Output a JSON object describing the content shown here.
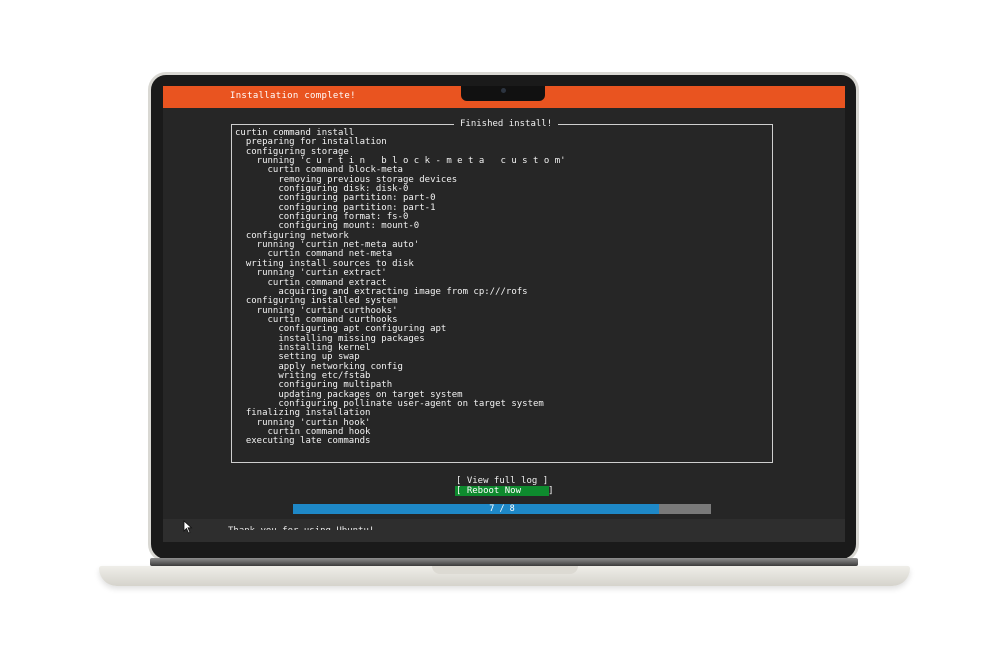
{
  "header": {
    "title": "Installation complete!"
  },
  "log": {
    "frame_title": "Finished install!",
    "lines": [
      "curtin command install",
      "  preparing for installation",
      "  configuring storage",
      "    running 'c u r t i n   b l o c k - m e t a   c u s t o m'",
      "      curtin command block-meta",
      "        removing previous storage devices",
      "        configuring disk: disk-0",
      "        configuring partition: part-0",
      "        configuring partition: part-1",
      "        configuring format: fs-0",
      "        configuring mount: mount-0",
      "  configuring network",
      "    running 'curtin net-meta auto'",
      "      curtin command net-meta",
      "  writing install sources to disk",
      "    running 'curtin extract'",
      "      curtin command extract",
      "        acquiring and extracting image from cp:///rofs",
      "  configuring installed system",
      "    running 'curtin curthooks'",
      "      curtin command curthooks",
      "        configuring apt configuring apt",
      "        installing missing packages",
      "        installing kernel",
      "        setting up swap",
      "        apply networking config",
      "        writing etc/fstab",
      "        configuring multipath",
      "        updating packages on target system",
      "        configuring pollinate user-agent on target system",
      "  finalizing installation",
      "    running 'curtin hook'",
      "      curtin command hook",
      "  executing late commands"
    ]
  },
  "actions": {
    "view_log_label": "[ View full log ]",
    "reboot_label": "[ Reboot Now     ]"
  },
  "progress": {
    "label": "7 / 8",
    "fraction": 0.875
  },
  "footer": {
    "text": "Thank you for using Ubuntu!"
  },
  "colors": {
    "accent": "#e95420",
    "progress": "#1e88c7",
    "reboot": "#0e8a2e"
  },
  "icons": {
    "pointer": "mouse-pointer-icon"
  }
}
